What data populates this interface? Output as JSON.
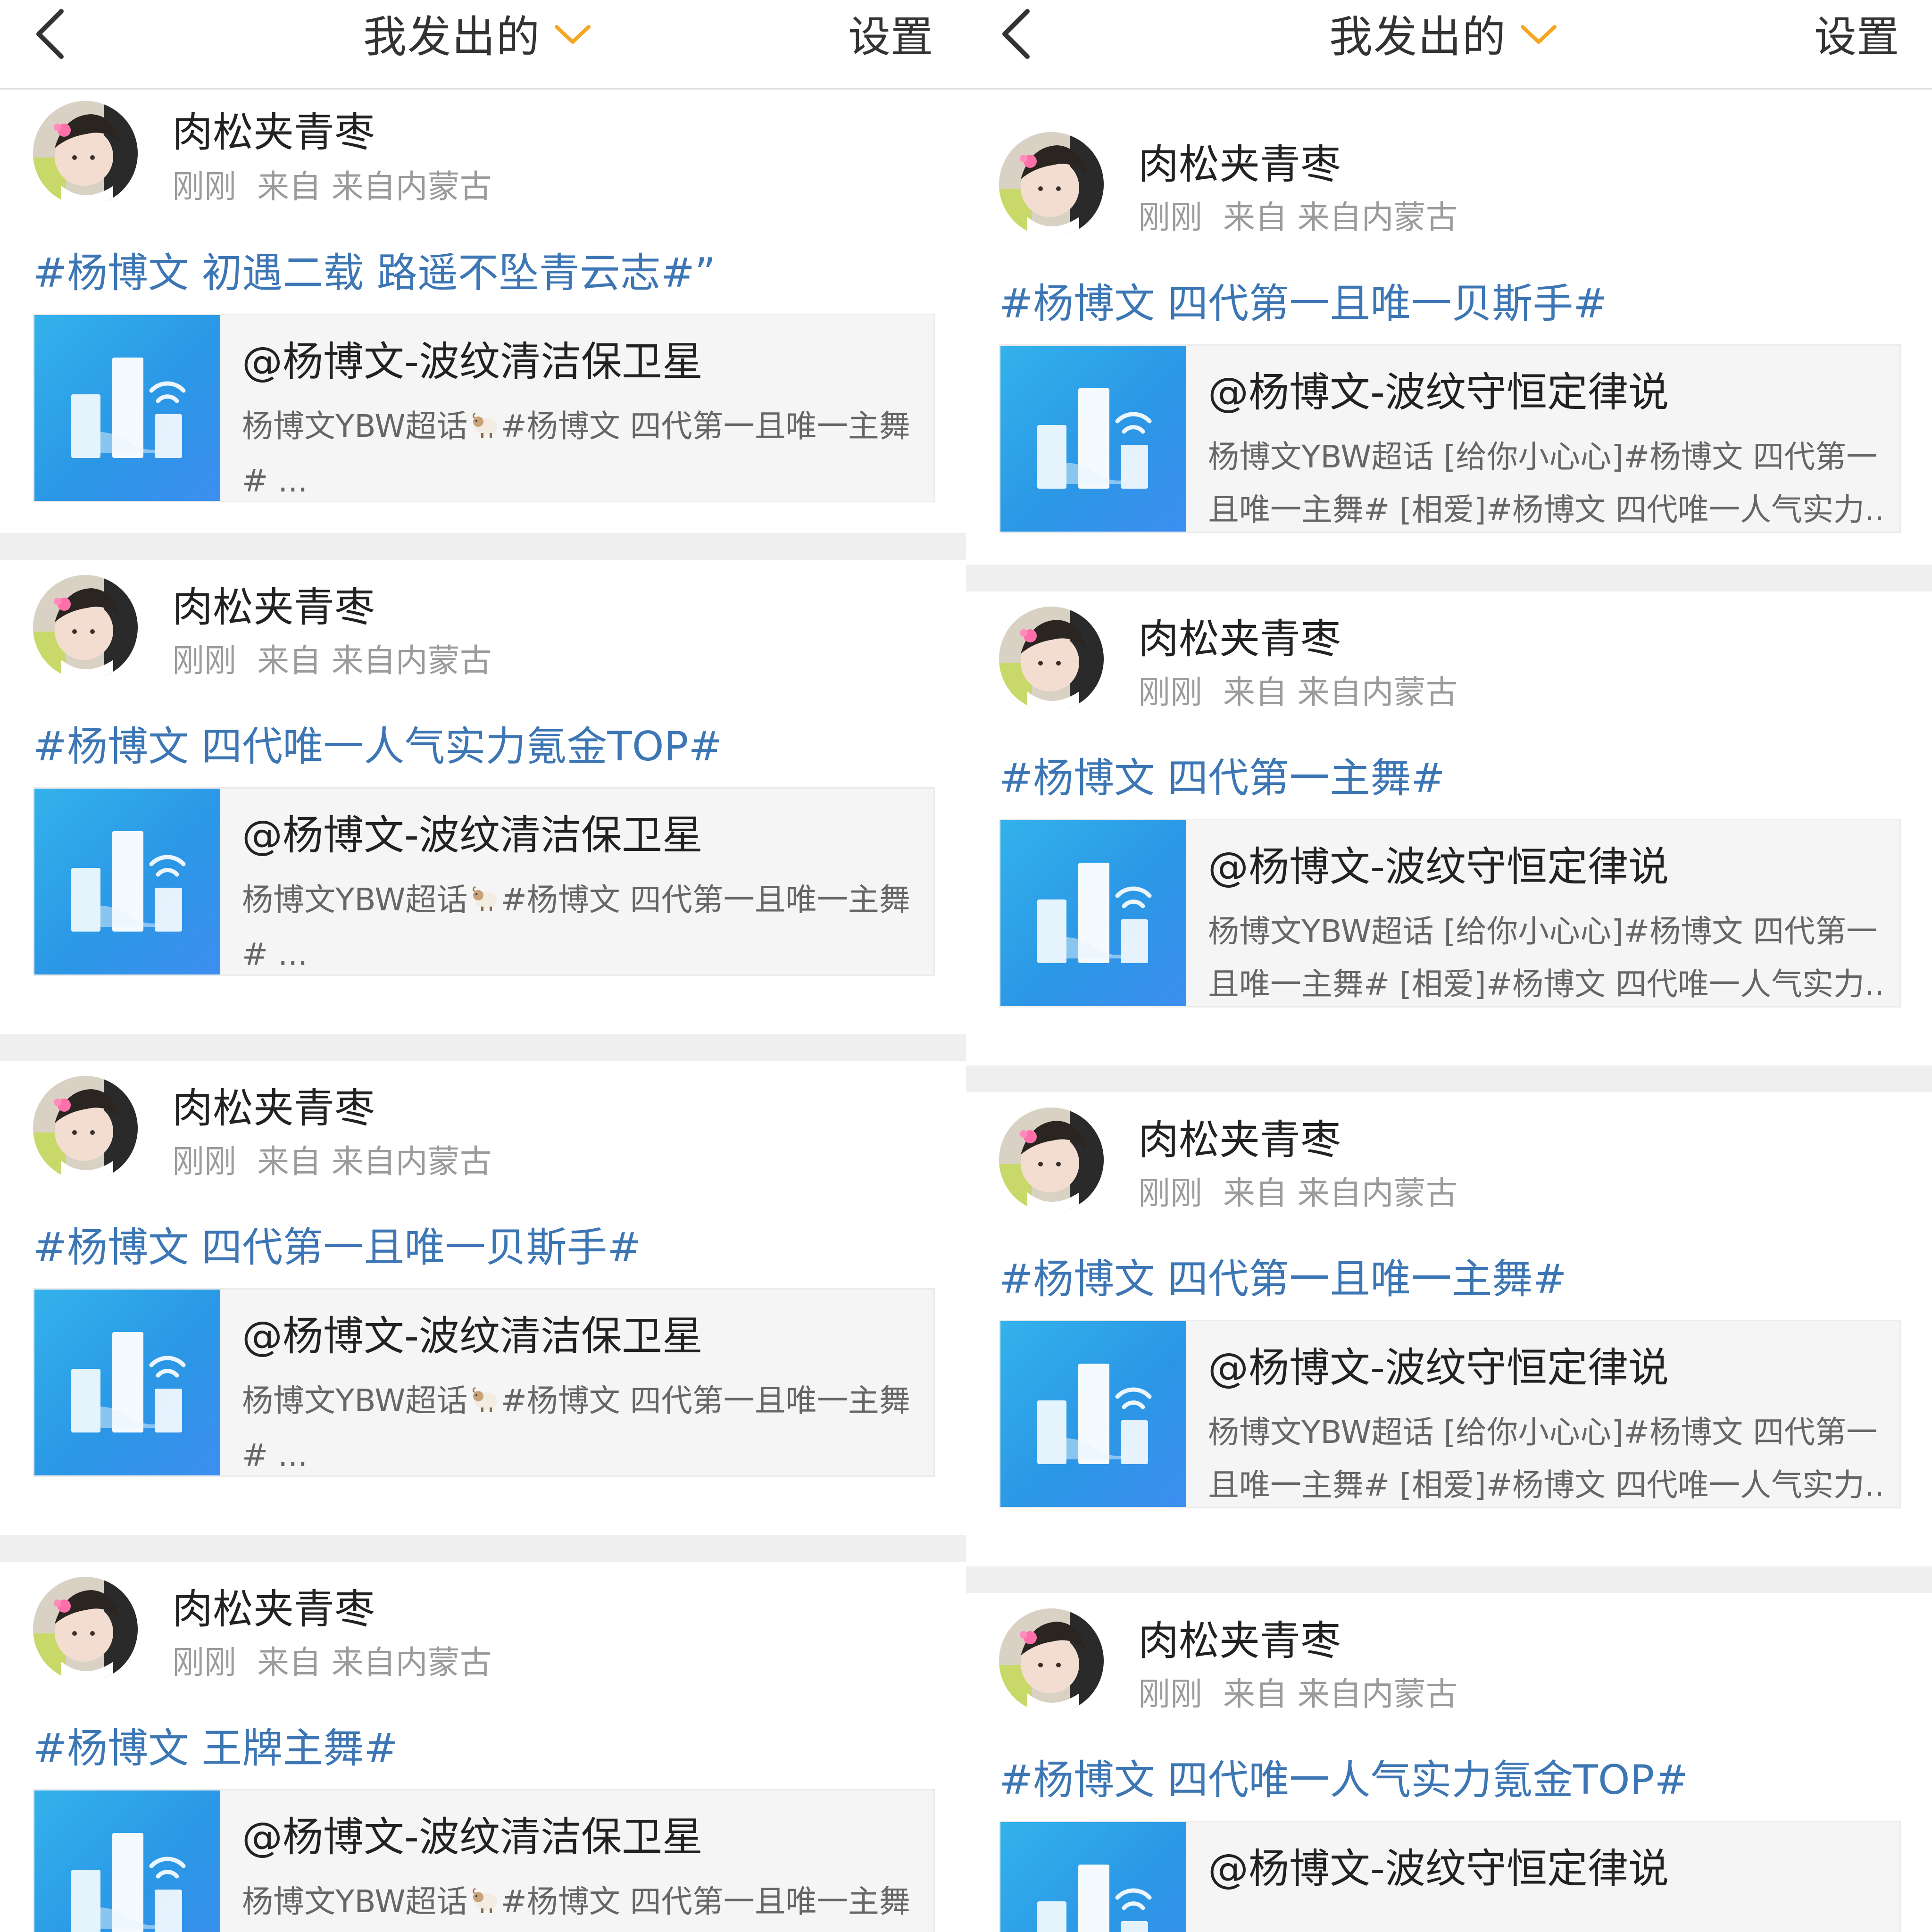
{
  "left_panel": {
    "header": {
      "title": "我发出的",
      "settings_label": "设置"
    },
    "posts": [
      {
        "username": "肉松夹青枣",
        "time": "刚刚",
        "source": "来自 来自内蒙古",
        "text": "#杨博文 初遇二载 路遥不坠青云志#”",
        "card": {
          "title": "@杨博文-波纹清洁保卫星",
          "desc_pre": "杨博文YBW超话",
          "desc_post": "#杨博文 四代第一且唯一主舞",
          "desc_line2": "# ..."
        }
      },
      {
        "username": "肉松夹青枣",
        "time": "刚刚",
        "source": "来自 来自内蒙古",
        "text": "#杨博文 四代唯一人气实力氪金TOP#",
        "card": {
          "title": "@杨博文-波纹清洁保卫星",
          "desc_pre": "杨博文YBW超话",
          "desc_post": "#杨博文 四代第一且唯一主舞",
          "desc_line2": "# ..."
        }
      },
      {
        "username": "肉松夹青枣",
        "time": "刚刚",
        "source": "来自 来自内蒙古",
        "text": "#杨博文 四代第一且唯一贝斯手#",
        "card": {
          "title": "@杨博文-波纹清洁保卫星",
          "desc_pre": "杨博文YBW超话",
          "desc_post": "#杨博文 四代第一且唯一主舞",
          "desc_line2": "# ..."
        }
      },
      {
        "username": "肉松夹青枣",
        "time": "刚刚",
        "source": "来自 来自内蒙古",
        "text": "#杨博文 王牌主舞#",
        "card": {
          "title": "@杨博文-波纹清洁保卫星",
          "desc_pre": "杨博文YBW超话",
          "desc_post": "#杨博文 四代第一且唯一主舞",
          "desc_line2": "# ..."
        }
      }
    ]
  },
  "right_panel": {
    "header": {
      "title": "我发出的",
      "settings_label": "设置"
    },
    "posts": [
      {
        "username": "肉松夹青枣",
        "time": "刚刚",
        "source": "来自 来自内蒙古",
        "text": "#杨博文 四代第一且唯一贝斯手#",
        "card": {
          "title": "@杨博文-波纹守恒定律说",
          "desc_line1": "杨博文YBW超话 [给你小心心]#杨博文 四代第一",
          "desc_line2": "且唯一主舞# [相爱]#杨博文 四代唯一人气实力..."
        }
      },
      {
        "username": "肉松夹青枣",
        "time": "刚刚",
        "source": "来自 来自内蒙古",
        "text": "#杨博文 四代第一主舞#",
        "card": {
          "title": "@杨博文-波纹守恒定律说",
          "desc_line1": "杨博文YBW超话 [给你小心心]#杨博文 四代第一",
          "desc_line2": "且唯一主舞# [相爱]#杨博文 四代唯一人气实力..."
        }
      },
      {
        "username": "肉松夹青枣",
        "time": "刚刚",
        "source": "来自 来自内蒙古",
        "text": "#杨博文 四代第一且唯一主舞#",
        "card": {
          "title": "@杨博文-波纹守恒定律说",
          "desc_line1": "杨博文YBW超话 [给你小心心]#杨博文 四代第一",
          "desc_line2": "且唯一主舞# [相爱]#杨博文 四代唯一人气实力..."
        }
      },
      {
        "username": "肉松夹青枣",
        "time": "刚刚",
        "source": "来自 来自内蒙古",
        "text": "#杨博文 四代唯一人气实力氪金TOP#",
        "card": {
          "title": "@杨博文-波纹守恒定律说",
          "desc_line1": "",
          "desc_line2": ""
        }
      }
    ]
  },
  "colors": {
    "topic_link": "#3d76b4",
    "thumb_blue": "#2b97e5",
    "separator": "#efefef"
  }
}
